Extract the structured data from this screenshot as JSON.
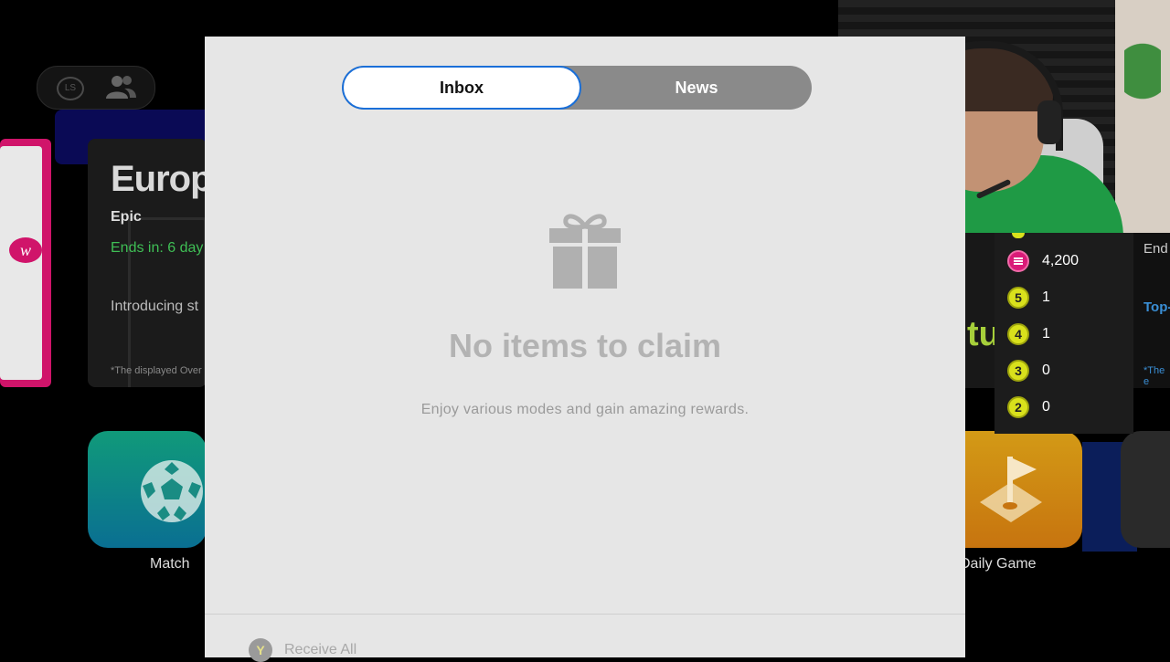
{
  "background": {
    "event_card": {
      "title": "Europ",
      "tier": "Epic",
      "ends": "Ends in: 6 day",
      "intro": "Introducing st",
      "note": "*The displayed Over"
    },
    "tiles": {
      "match_label": "Match",
      "daily_game_label": "Daily Game"
    },
    "right_card": {
      "ends": "End",
      "top": "Top-",
      "note": "*The e",
      "green_text": "tu"
    },
    "ls_label": "LS"
  },
  "currency": {
    "coins": "4,200",
    "items": [
      {
        "badge": "5",
        "count": "1"
      },
      {
        "badge": "4",
        "count": "1"
      },
      {
        "badge": "3",
        "count": "0"
      },
      {
        "badge": "2",
        "count": "0"
      }
    ],
    "coin_color": "#d91a78",
    "ball_color": "#d9e11c"
  },
  "modal": {
    "tabs": [
      {
        "label": "Inbox",
        "active": true
      },
      {
        "label": "News",
        "active": false
      }
    ],
    "empty_title": "No items to claim",
    "empty_subtitle": "Enjoy various modes and gain amazing rewards.",
    "footer": {
      "button_glyph": "Y",
      "label": "Receive All"
    },
    "accent_color": "#1a6fd8"
  }
}
